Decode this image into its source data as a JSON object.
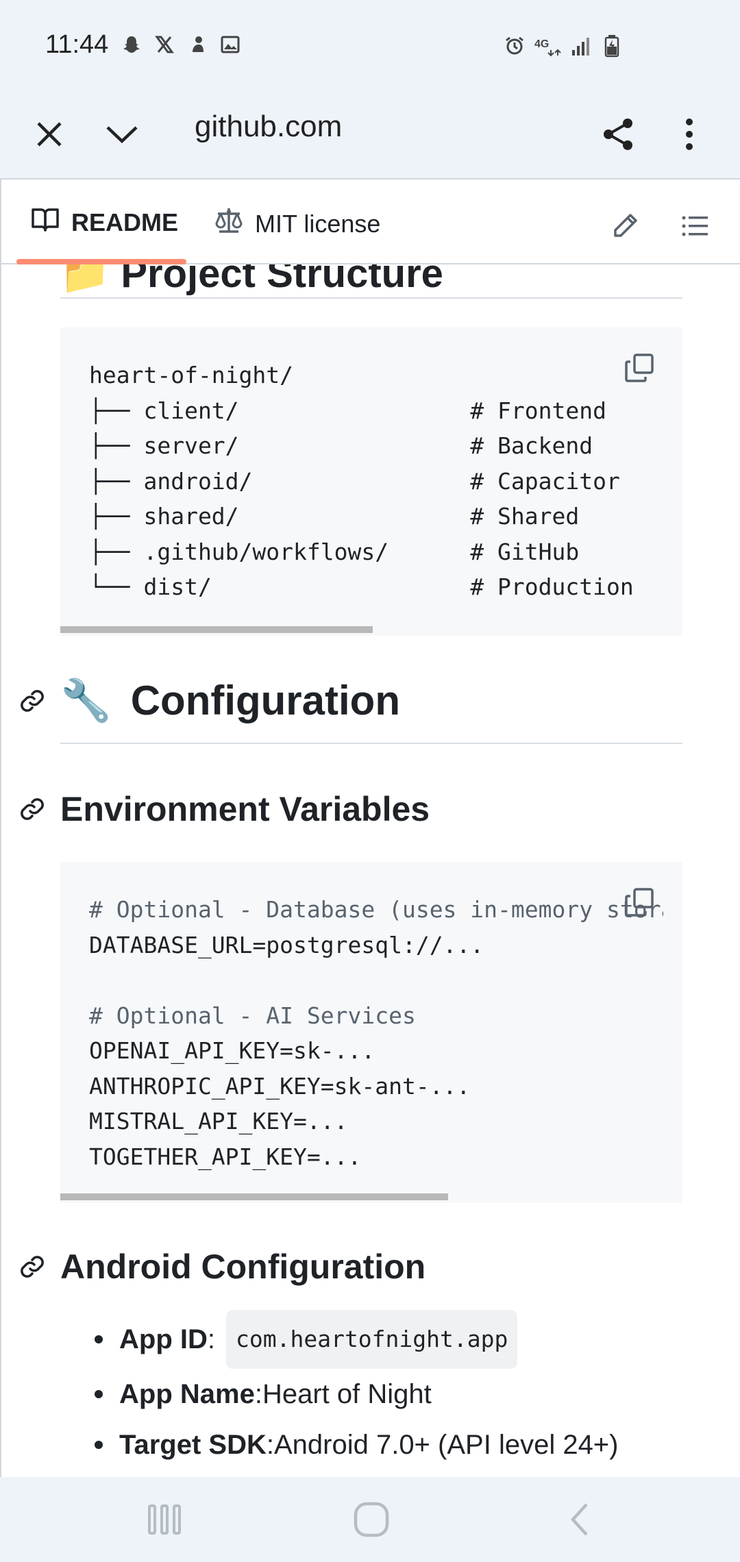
{
  "status_bar": {
    "time": "11:44",
    "left_icons": [
      "snapchat-icon",
      "x-icon",
      "notification-icon",
      "gallery-icon"
    ],
    "right_icons": [
      "alarm-icon",
      "4g-icon",
      "signal-icon",
      "battery-icon"
    ]
  },
  "browser": {
    "url": "github.com",
    "close_icon": "close-icon",
    "minimize_icon": "chevron-down-icon",
    "share_icon": "share-icon",
    "menu_icon": "more-vert-icon"
  },
  "tabs": {
    "readme": "README",
    "license": "MIT license"
  },
  "partial_heading": "📁 Project Structure",
  "project_structure": {
    "lines": [
      "heart-of-night/",
      "├── client/                 # Frontend",
      "├── server/                 # Backend",
      "├── android/                # Capacitor",
      "├── shared/                 # Shared",
      "├── .github/workflows/      # GitHub",
      "└── dist/                   # Production"
    ]
  },
  "configuration_heading": {
    "emoji": "🔧",
    "text": "Configuration"
  },
  "env_heading": "Environment Variables",
  "env_code": {
    "lines": [
      "# Optional - Database (uses in-memory storage if not set)",
      "DATABASE_URL=postgresql://...",
      "",
      "# Optional - AI Services",
      "OPENAI_API_KEY=sk-...",
      "ANTHROPIC_API_KEY=sk-ant-...",
      "MISTRAL_API_KEY=...",
      "TOGETHER_API_KEY=..."
    ]
  },
  "android_heading": "Android Configuration",
  "android_config": [
    {
      "label": "App ID",
      "sep": ": ",
      "code": "com.heartofnight.app"
    },
    {
      "label": "App Name",
      "sep": ": ",
      "value": "Heart of Night"
    },
    {
      "label": "Target SDK",
      "sep": ": ",
      "value": "Android 7.0+ (API level 24+)"
    }
  ],
  "colors": {
    "accent_tab_underline": "#fd8c73",
    "code_bg": "#f6f8fa",
    "chrome_bg": "#eef3fa"
  }
}
